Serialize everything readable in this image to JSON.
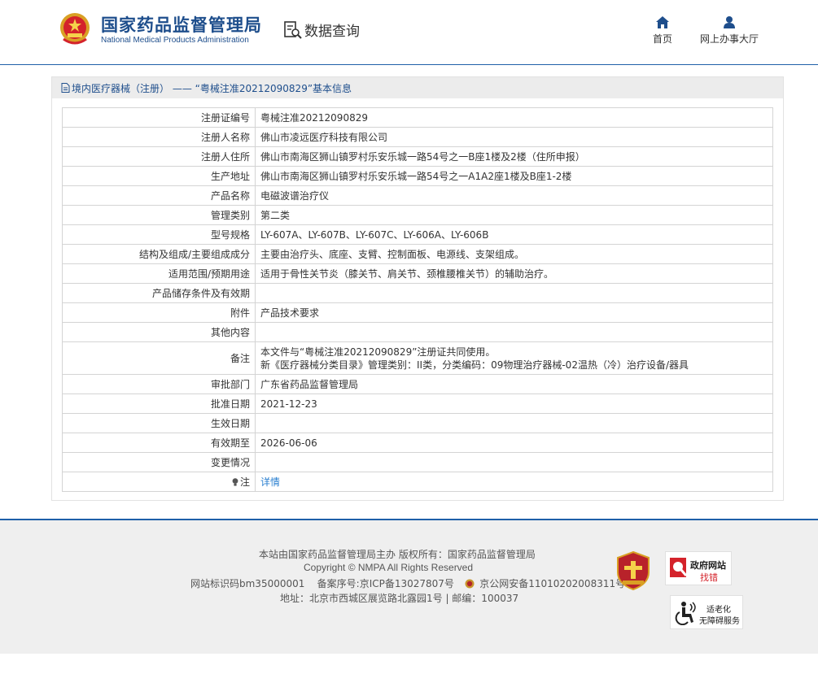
{
  "header": {
    "logo_cn": "国家药品监督管理局",
    "logo_en": "National Medical Products Administration",
    "query_label": "数据查询",
    "nav": [
      {
        "label": "首页",
        "icon": "home-icon"
      },
      {
        "label": "网上办事大厅",
        "icon": "user-icon"
      }
    ]
  },
  "breadcrumb": {
    "text": "境内医疗器械（注册） —— “粤械注准20212090829”基本信息"
  },
  "info": {
    "rows": [
      {
        "label": "注册证编号",
        "value": "粤械注准20212090829"
      },
      {
        "label": "注册人名称",
        "value": "佛山市凌远医疗科技有限公司"
      },
      {
        "label": "注册人住所",
        "value": "佛山市南海区狮山镇罗村乐安乐城一路54号之一B座1楼及2楼（住所申报）"
      },
      {
        "label": "生产地址",
        "value": "佛山市南海区狮山镇罗村乐安乐城一路54号之一A1A2座1楼及B座1-2楼"
      },
      {
        "label": "产品名称",
        "value": "电磁波谱治疗仪"
      },
      {
        "label": "管理类别",
        "value": "第二类"
      },
      {
        "label": "型号规格",
        "value": "LY-607A、LY-607B、LY-607C、LY-606A、LY-606B"
      },
      {
        "label": "结构及组成/主要组成成分",
        "value": "主要由治疗头、底座、支臂、控制面板、电源线、支架组成。"
      },
      {
        "label": "适用范围/预期用途",
        "value": "适用于骨性关节炎（膝关节、肩关节、颈椎腰椎关节）的辅助治疗。"
      },
      {
        "label": "产品储存条件及有效期",
        "value": ""
      },
      {
        "label": "附件",
        "value": "产品技术要求"
      },
      {
        "label": "其他内容",
        "value": ""
      }
    ],
    "remark_label": "备注",
    "remark_line1": "本文件与“粤械注准20212090829”注册证共同使用。",
    "remark_line2": "新《医疗器械分类目录》管理类别：II类，分类编码：09物理治疗器械-02温热（冷）治疗设备/器具",
    "rows2": [
      {
        "label": "审批部门",
        "value": "广东省药品监督管理局"
      },
      {
        "label": "批准日期",
        "value": "2021-12-23"
      },
      {
        "label": "生效日期",
        "value": ""
      },
      {
        "label": "有效期至",
        "value": "2026-06-06"
      },
      {
        "label": "变更情况",
        "value": ""
      }
    ],
    "note_label": "注",
    "note_link": "详情"
  },
  "footer": {
    "line1": "本站由国家药品监督管理局主办 版权所有：国家药品监督管理局",
    "line2": "Copyright © NMPA All Rights Reserved",
    "site_id": "网站标识码bm35000001",
    "icp": "备案序号:京ICP备13027807号",
    "police": "京公网安备11010202008311号",
    "line4": "地址：北京市西城区展览路北露园1号 | 邮编：100037",
    "badge_error_1": "政府网站",
    "badge_error_2": "找错",
    "badge_elder_1": "适老化",
    "badge_elder_2": "无障碍服务"
  },
  "colors": {
    "brand_blue": "#1e4e8c",
    "link_blue": "#2a7fd0",
    "alert_red": "#d4232b"
  }
}
